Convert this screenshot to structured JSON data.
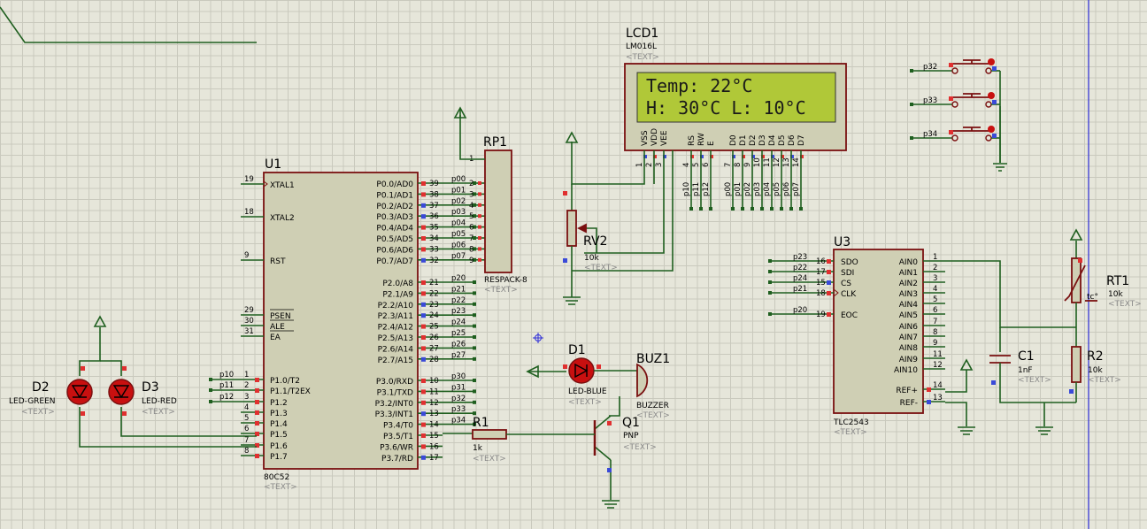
{
  "text_tag": "<TEXT>",
  "lcd": {
    "ref": "LCD1",
    "part": "LM016L",
    "line1": "Temp: 22°C",
    "line2": "H: 30°C L: 10°C",
    "pins": [
      "VSS",
      "VDD",
      "VEE",
      "RS",
      "RW",
      "E",
      "D0",
      "D1",
      "D2",
      "D3",
      "D4",
      "D5",
      "D6",
      "D7"
    ],
    "pin_numbers": [
      "1",
      "2",
      "3",
      "4",
      "5",
      "6",
      "7",
      "8",
      "9",
      "10",
      "11",
      "12",
      "13",
      "14"
    ],
    "nets": [
      "p10",
      "p11",
      "p12",
      "p00",
      "p01",
      "p02",
      "p03",
      "p04",
      "p05",
      "p06",
      "p07"
    ]
  },
  "u1": {
    "ref": "U1",
    "part": "80C52",
    "left": [
      {
        "n": "19",
        "name": "XTAL1"
      },
      {
        "n": "18",
        "name": "XTAL2"
      },
      {
        "n": "9",
        "name": "RST"
      },
      {
        "n": "29",
        "name": "PSEN"
      },
      {
        "n": "30",
        "name": "ALE"
      },
      {
        "n": "31",
        "name": "EA"
      },
      {
        "n": "1",
        "name": "P1.0/T2",
        "net": "p10"
      },
      {
        "n": "2",
        "name": "P1.1/T2EX",
        "net": "p11"
      },
      {
        "n": "3",
        "name": "P1.2",
        "net": "p12"
      },
      {
        "n": "4",
        "name": "P1.3"
      },
      {
        "n": "5",
        "name": "P1.4"
      },
      {
        "n": "6",
        "name": "P1.5"
      },
      {
        "n": "7",
        "name": "P1.6"
      },
      {
        "n": "8",
        "name": "P1.7"
      }
    ],
    "right": [
      {
        "n": "39",
        "name": "P0.0/AD0",
        "net": "p00"
      },
      {
        "n": "38",
        "name": "P0.1/AD1",
        "net": "p01"
      },
      {
        "n": "37",
        "name": "P0.2/AD2",
        "net": "p02"
      },
      {
        "n": "36",
        "name": "P0.3/AD3",
        "net": "p03"
      },
      {
        "n": "35",
        "name": "P0.4/AD4",
        "net": "p04"
      },
      {
        "n": "34",
        "name": "P0.5/AD5",
        "net": "p05"
      },
      {
        "n": "33",
        "name": "P0.6/AD6",
        "net": "p06"
      },
      {
        "n": "32",
        "name": "P0.7/AD7",
        "net": "p07"
      },
      {
        "n": "21",
        "name": "P2.0/A8",
        "net": "p20"
      },
      {
        "n": "22",
        "name": "P2.1/A9",
        "net": "p21"
      },
      {
        "n": "23",
        "name": "P2.2/A10",
        "net": "p22"
      },
      {
        "n": "24",
        "name": "P2.3/A11",
        "net": "p23"
      },
      {
        "n": "25",
        "name": "P2.4/A12",
        "net": "p24"
      },
      {
        "n": "26",
        "name": "P2.5/A13",
        "net": "p25"
      },
      {
        "n": "27",
        "name": "P2.6/A14",
        "net": "p26"
      },
      {
        "n": "28",
        "name": "P2.7/A15",
        "net": "p27"
      },
      {
        "n": "10",
        "name": "P3.0/RXD",
        "net": "p30"
      },
      {
        "n": "11",
        "name": "P3.1/TXD",
        "net": "p31"
      },
      {
        "n": "12",
        "name": "P3.2/INT0",
        "net": "p32"
      },
      {
        "n": "13",
        "name": "P3.3/INT1",
        "net": "p33"
      },
      {
        "n": "14",
        "name": "P3.4/T0",
        "net": "p34"
      },
      {
        "n": "15",
        "name": "P3.5/T1"
      },
      {
        "n": "16",
        "name": "P3.6/WR"
      },
      {
        "n": "17",
        "name": "P3.7/RD"
      }
    ]
  },
  "rp1": {
    "ref": "RP1",
    "part": "RESPACK-8",
    "pin1": "1",
    "pins": [
      "2",
      "3",
      "4",
      "5",
      "6",
      "7",
      "8",
      "9"
    ]
  },
  "rv2": {
    "ref": "RV2",
    "value": "10k"
  },
  "u3": {
    "ref": "U3",
    "part": "TLC2543",
    "left": [
      {
        "n": "16",
        "name": "SDO",
        "net": "p23"
      },
      {
        "n": "17",
        "name": "SDI",
        "net": "p22"
      },
      {
        "n": "15",
        "name": "CS",
        "net": "p24"
      },
      {
        "n": "18",
        "name": "CLK",
        "net": "p21"
      },
      {
        "n": "19",
        "name": "EOC",
        "net": "p20"
      }
    ],
    "right": [
      {
        "n": "1",
        "name": "AIN0"
      },
      {
        "n": "2",
        "name": "AIN1"
      },
      {
        "n": "3",
        "name": "AIN2"
      },
      {
        "n": "4",
        "name": "AIN3"
      },
      {
        "n": "5",
        "name": "AIN4"
      },
      {
        "n": "6",
        "name": "AIN5"
      },
      {
        "n": "7",
        "name": "AIN6"
      },
      {
        "n": "8",
        "name": "AIN7"
      },
      {
        "n": "9",
        "name": "AIN8"
      },
      {
        "n": "11",
        "name": "AIN9"
      },
      {
        "n": "12",
        "name": "AIN10"
      },
      {
        "n": "14",
        "name": "REF+"
      },
      {
        "n": "13",
        "name": "REF-"
      }
    ]
  },
  "rt1": {
    "ref": "RT1",
    "value": "10k",
    "mark": "tc°"
  },
  "c1": {
    "ref": "C1",
    "value": "1nF"
  },
  "r2": {
    "ref": "R2",
    "value": "10k"
  },
  "d1": {
    "ref": "D1",
    "part": "LED-BLUE"
  },
  "d2": {
    "ref": "D2",
    "part": "LED-GREEN"
  },
  "d3": {
    "ref": "D3",
    "part": "LED-RED"
  },
  "buz1": {
    "ref": "BUZ1",
    "part": "BUZZER"
  },
  "q1": {
    "ref": "Q1",
    "part": "PNP"
  },
  "r1": {
    "ref": "R1",
    "value": "1k"
  },
  "buttons": [
    "p32",
    "p33",
    "p34"
  ],
  "lcd_pins_small": true
}
